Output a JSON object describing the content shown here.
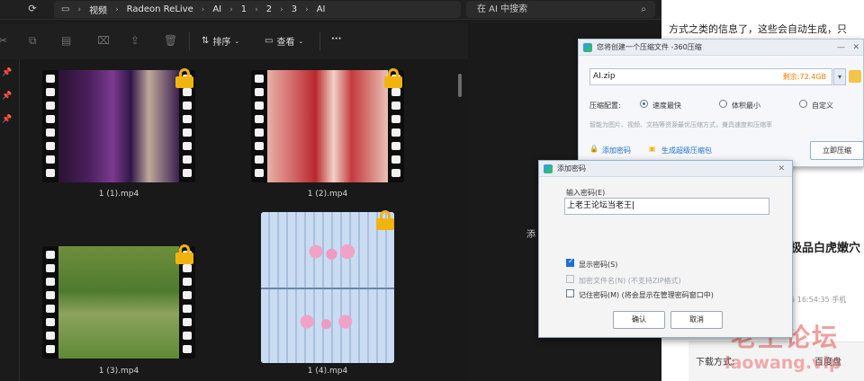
{
  "explorer": {
    "breadcrumb": [
      "视频",
      "Radeon ReLive",
      "AI",
      "1",
      "2",
      "3",
      "AI"
    ],
    "search_placeholder": "在 AI 中搜索",
    "toolbar": {
      "sort_label": "排序",
      "view_label": "查看",
      "more_label": "···"
    }
  },
  "files": [
    {
      "name": "1 (1).mp4"
    },
    {
      "name": "1 (2).mp4"
    },
    {
      "name": "1 (3).mp4"
    },
    {
      "name": "1 (4).mp4"
    }
  ],
  "partial_text": "添",
  "background_page": {
    "line1": "方式之类的信息了，这些会自动生成，只",
    "heading": "极品白虎嫩穴",
    "meta": "25 16:54:35 手机",
    "download_label": "下载方式:",
    "download_value": "百度盘",
    "watermark_cn": "老王论坛",
    "watermark_url": "laowang.vip"
  },
  "compress_window": {
    "title": "您将创建一个压缩文件 -360压缩",
    "filename": "AI.zip",
    "free_space": "剩余:72.4GB",
    "config_label": "压缩配置:",
    "options": [
      {
        "label": "速度最快",
        "selected": true
      },
      {
        "label": "体积最小",
        "selected": false
      },
      {
        "label": "自定义",
        "selected": false
      }
    ],
    "hint": "智能为图片、视频、文档等资源最优压缩方式，兼具速度和压缩率",
    "add_password": "添加密码",
    "make_exe": "生成超级压缩包",
    "compress_button": "立即压缩"
  },
  "password_dialog": {
    "title": "添加密码",
    "input_label": "输入密码(E)",
    "input_value": "上老王论坛当老王",
    "show_password": "显示密码(S)",
    "encrypt_filenames": "加密文件名(N) (不支持ZIP格式)",
    "remember_password": "记住密码(M) (将会显示在管理密码窗口中)",
    "ok": "确认",
    "cancel": "取消"
  },
  "colors": {
    "lock": "#f1b40f",
    "accent": "#1e6fd9",
    "watermark": "#e65050"
  }
}
